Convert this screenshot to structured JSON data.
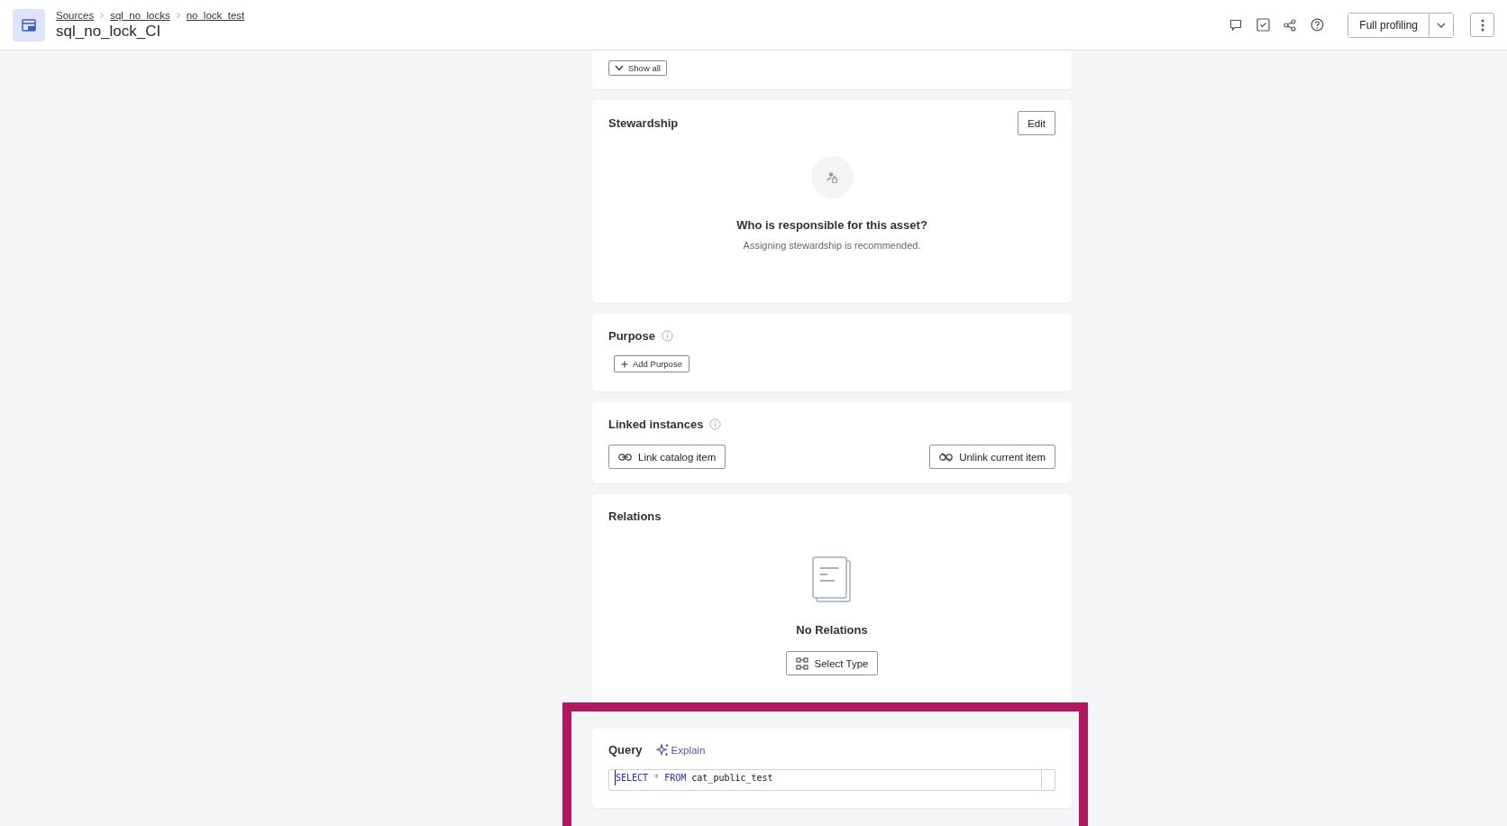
{
  "header": {
    "breadcrumbs": [
      "Sources",
      "sql_no_locks",
      "no_lock_test"
    ],
    "title": "sql_no_lock_CI",
    "primary_button": "Full profiling"
  },
  "overview": {
    "show_all": "Show all"
  },
  "stewardship": {
    "title": "Stewardship",
    "edit": "Edit",
    "empty_title": "Who is responsible for this asset?",
    "empty_text": "Assigning stewardship is recommended."
  },
  "purpose": {
    "title": "Purpose",
    "add": "Add Purpose"
  },
  "linked_instances": {
    "title": "Linked instances",
    "link": "Link catalog item",
    "unlink": "Unlink current item"
  },
  "relations": {
    "title": "Relations",
    "empty_title": "No Relations",
    "select": "Select Type"
  },
  "query": {
    "title": "Query",
    "explain": "Explain",
    "highlighted": true,
    "tokens": [
      {
        "kind": "keyword",
        "text": "SELECT"
      },
      {
        "kind": "operator",
        "text": "*"
      },
      {
        "kind": "keyword",
        "text": "FROM"
      },
      {
        "kind": "identifier",
        "text": "cat_public_test"
      }
    ]
  }
}
